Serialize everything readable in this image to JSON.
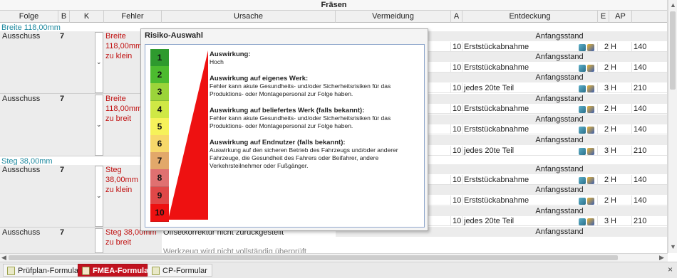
{
  "section_title": "Fräsen",
  "columns": [
    "Folge",
    "B",
    "K",
    "Fehler",
    "Ursache",
    "Vermeidung",
    "A",
    "Entdeckung",
    "E",
    "AP"
  ],
  "groups": [
    {
      "label": "Breite 118,00mm"
    },
    {
      "label": "Steg 38,00mm"
    }
  ],
  "rows": [
    {
      "folge": "Ausschuss",
      "b": "7",
      "fehler": "Breite 118,00mm zu klein"
    },
    {
      "folge": "Ausschuss",
      "b": "7",
      "fehler": "Breite 118,00mm zu breit"
    },
    {
      "folge": "Ausschuss",
      "b": "7",
      "fehler": "Steg 38,00mm zu klein"
    },
    {
      "folge": "Ausschuss",
      "b": "7",
      "fehler": "Steg 38,00mm zu breit"
    }
  ],
  "ursache_partial": [
    "Offsetkorrektur nicht zurückgestellt",
    "Werkzeug wird nicht vollständig überprüft"
  ],
  "entdeckung_rows": [
    {
      "type": "header",
      "text": "Anfangsstand"
    },
    {
      "type": "data",
      "a": "10",
      "entdeckung": "Erststückabnahme",
      "e": "2",
      "ap": "H",
      "rpz": "140"
    },
    {
      "type": "header",
      "text": "Anfangsstand"
    },
    {
      "type": "data",
      "a": "10",
      "entdeckung": "Erststückabnahme",
      "e": "2",
      "ap": "H",
      "rpz": "140"
    },
    {
      "type": "header",
      "text": "Anfangsstand"
    },
    {
      "type": "data",
      "a": "10",
      "entdeckung": "jedes 20te Teil",
      "e": "3",
      "ap": "H",
      "rpz": "210"
    },
    {
      "type": "header",
      "text": "Anfangsstand"
    },
    {
      "type": "data",
      "a": "10",
      "entdeckung": "Erststückabnahme",
      "e": "2",
      "ap": "H",
      "rpz": "140"
    },
    {
      "type": "header",
      "text": "Anfangsstand"
    },
    {
      "type": "data",
      "a": "10",
      "entdeckung": "Erststückabnahme",
      "e": "2",
      "ap": "H",
      "rpz": "140"
    },
    {
      "type": "header",
      "text": "Anfangsstand"
    },
    {
      "type": "data",
      "a": "10",
      "entdeckung": "jedes 20te Teil",
      "e": "3",
      "ap": "H",
      "rpz": "210"
    },
    {
      "type": "gap"
    },
    {
      "type": "header",
      "text": "Anfangsstand"
    },
    {
      "type": "data",
      "a": "10",
      "entdeckung": "Erststückabnahme",
      "e": "2",
      "ap": "H",
      "rpz": "140"
    },
    {
      "type": "header",
      "text": "Anfangsstand"
    },
    {
      "type": "data",
      "a": "10",
      "entdeckung": "Erststückabnahme",
      "e": "2",
      "ap": "H",
      "rpz": "140"
    },
    {
      "type": "header",
      "text": "Anfangsstand"
    },
    {
      "type": "data",
      "a": "10",
      "entdeckung": "jedes 20te Teil",
      "e": "3",
      "ap": "H",
      "rpz": "210"
    },
    {
      "type": "header",
      "text": "Anfangsstand"
    }
  ],
  "popup": {
    "title": "Risiko-Auswahl",
    "levels": [
      "1",
      "2",
      "3",
      "4",
      "5",
      "6",
      "7",
      "8",
      "9",
      "10"
    ],
    "level_colors": [
      "#2e9a2e",
      "#4cbb2f",
      "#9bd43a",
      "#cfe845",
      "#f6f25a",
      "#f7d86a",
      "#e2a86a",
      "#e07070",
      "#e04848",
      "#ee1111"
    ],
    "selected_level": "10",
    "sections": [
      {
        "heading": "Auswirkung:",
        "text": "Hoch"
      },
      {
        "heading": "Auswirkung auf eigenes Werk:",
        "text": "Fehler kann akute Gesundheits- und/oder Sicherheitsrisiken für das Produktions- oder Montagepersonal zur Folge haben."
      },
      {
        "heading": "Auswirkung auf beliefertes Werk (falls bekannt):",
        "text": "Fehler kann akute Gesundheits- und/oder Sicherheitsrisiken für das Produktions- oder Montagepersonal zur Folge haben."
      },
      {
        "heading": "Auswirkung auf Endnutzer (falls bekannt):",
        "text": "Auswirkung auf den sicheren Betrieb des Fahrzeugs und/oder anderer Fahrzeuge, die Gesundheit des Fahrers oder Beifahrer, andere Verkehrsteilnehmer oder Fußgänger."
      }
    ]
  },
  "tabs": [
    {
      "label": "Prüfplan-Formular",
      "active": false,
      "icon": "form-icon"
    },
    {
      "label": "FMEA-Formular",
      "active": true,
      "icon": "form-icon"
    },
    {
      "label": "CP-Formular",
      "active": false,
      "icon": "form-icon"
    }
  ],
  "close_glyph": "×"
}
